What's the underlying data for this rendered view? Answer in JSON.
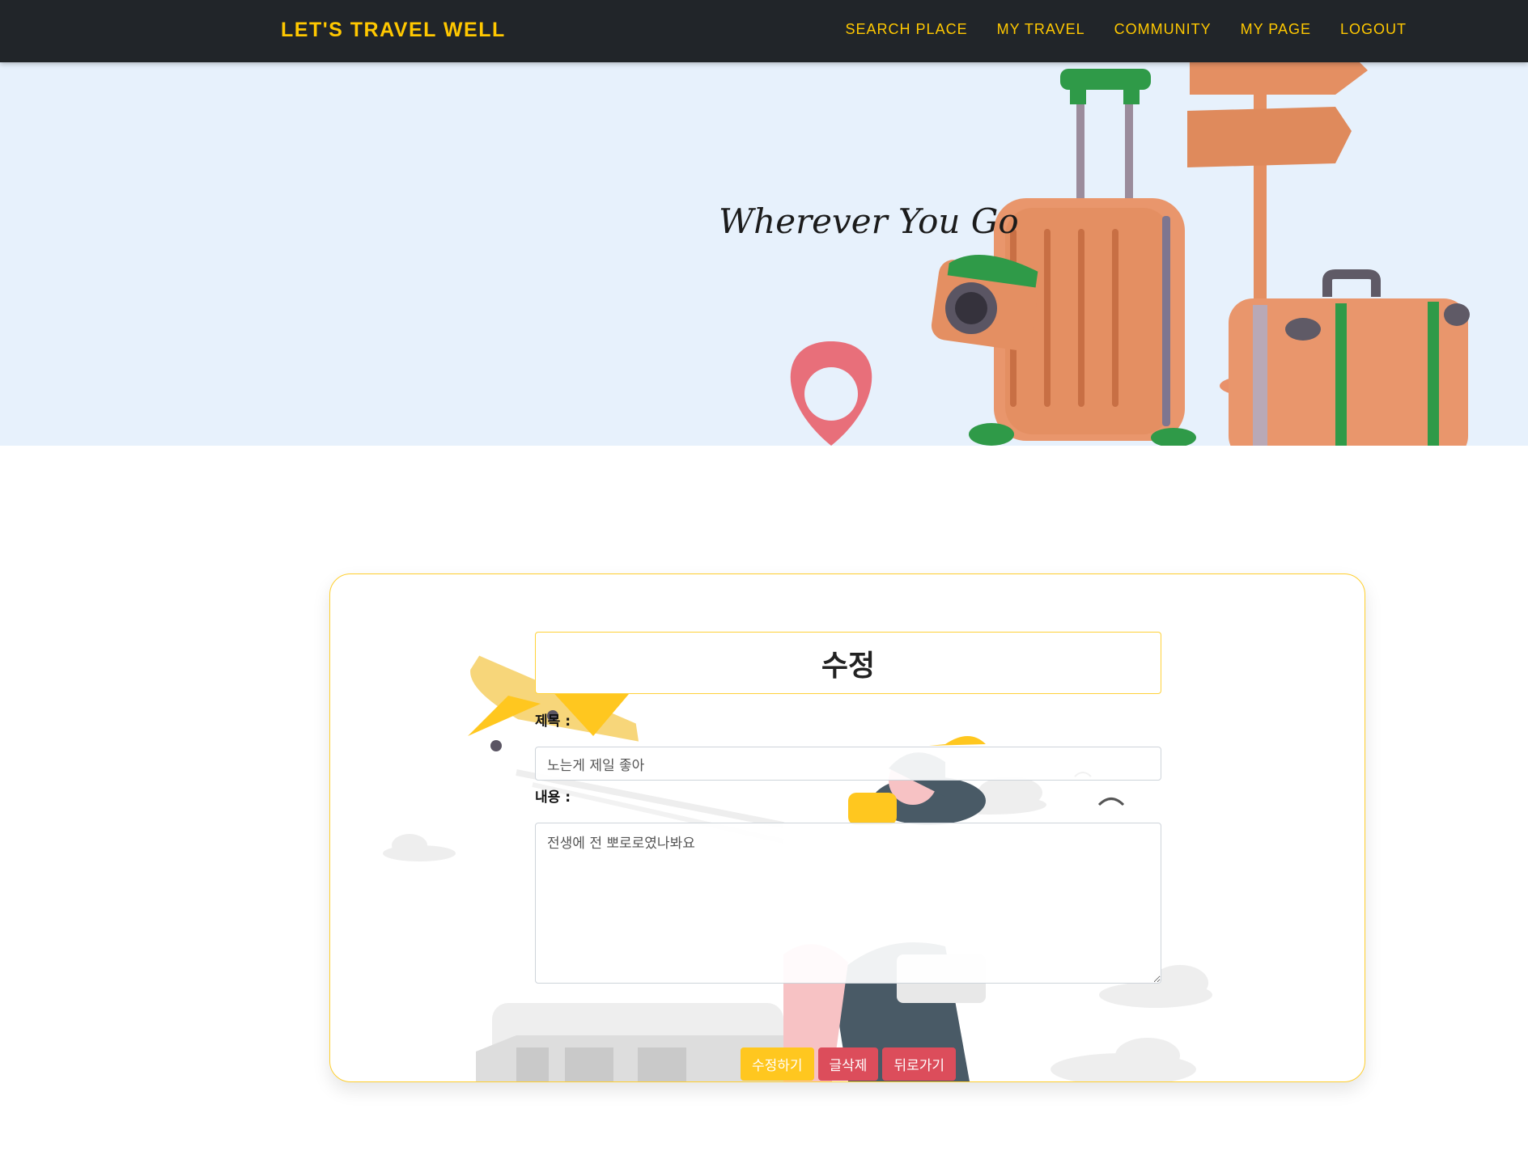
{
  "navbar": {
    "brand": "LET'S TRAVEL WELL",
    "links": [
      "SEARCH PLACE",
      "MY TRAVEL",
      "COMMUNITY",
      "MY PAGE",
      "LOGOUT"
    ]
  },
  "hero": {
    "title": "Wherever You Go"
  },
  "form": {
    "heading": "수정",
    "title_label": "제목 :",
    "title_value": "노는게 제일 좋아",
    "content_label": "내용 :",
    "content_value": "전생에 전 뽀로로였나봐요",
    "buttons": {
      "edit": "수정하기",
      "delete": "글삭제",
      "back": "뒤로가기"
    }
  },
  "colors": {
    "navbar_bg": "#212529",
    "accent": "#ffc800",
    "hero_bg": "#e7f1fc",
    "danger": "#dc4d5b"
  }
}
